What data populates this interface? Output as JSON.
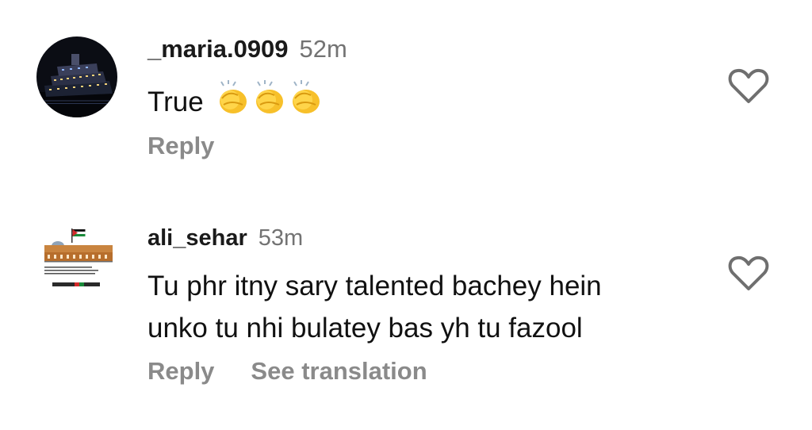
{
  "comments": [
    {
      "username": "_maria.0909",
      "time": "52m",
      "text": "True",
      "emoji": [
        "clapping-hands-icon",
        "clapping-hands-icon",
        "clapping-hands-icon"
      ],
      "reply_label": "Reply"
    },
    {
      "username": "ali_sehar",
      "time": "53m",
      "text_lines": [
        "Tu phr itny sary talented bachey hein",
        "unko tu nhi bulatey bas yh tu fazool"
      ],
      "avatar_caption": "Oh Allah, help and protect the people of palestine, ease their pain and bestow your mercy on them.",
      "avatar_banner": "FREE PALESTINE",
      "reply_label": "Reply",
      "translate_label": "See translation"
    }
  ],
  "colors": {
    "username": "#1a1a1a",
    "timestamp": "#737373",
    "action": "#8a8a8a",
    "icon": "#6f6f6f"
  }
}
